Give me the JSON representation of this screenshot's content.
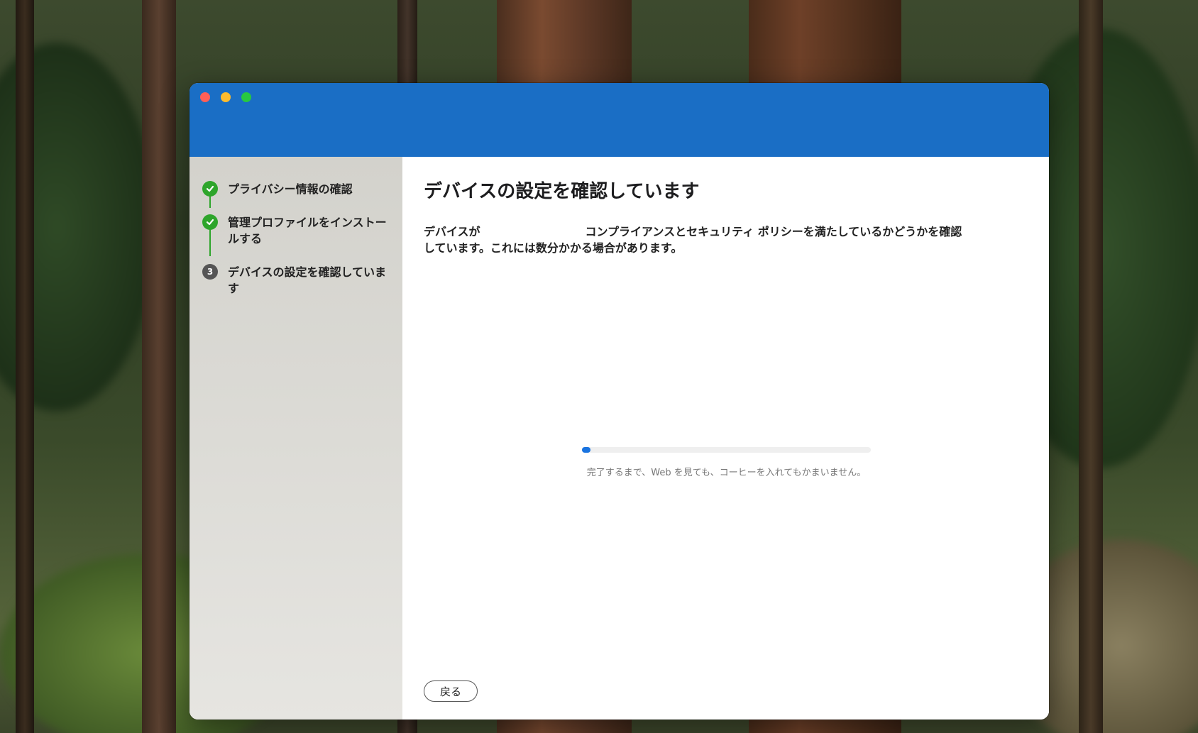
{
  "window": {
    "titlebar_color": "#1a6ec5"
  },
  "sidebar": {
    "steps": [
      {
        "label": "プライバシー情報の確認",
        "status": "done",
        "icon": "checkmark-icon"
      },
      {
        "label": "管理プロファイルをインストールする",
        "status": "done",
        "icon": "checkmark-icon"
      },
      {
        "label": "デバイスの設定を確認しています",
        "status": "current",
        "number": "3"
      }
    ],
    "done_color": "#2ea52b"
  },
  "main": {
    "title": "デバイスの設定を確認しています",
    "description_part1": "デバイスが",
    "description_part2": "コンプライアンスとセキュリティ ポリシーを満たしているかどうかを確認",
    "description_part3": "しています。これには数分かかる場合があります。",
    "progress": 0.03,
    "progress_color": "#1a74e0",
    "hint": "完了するまで、Web を見ても、コーヒーを入れてもかまいません。",
    "back_label": "戻る"
  }
}
